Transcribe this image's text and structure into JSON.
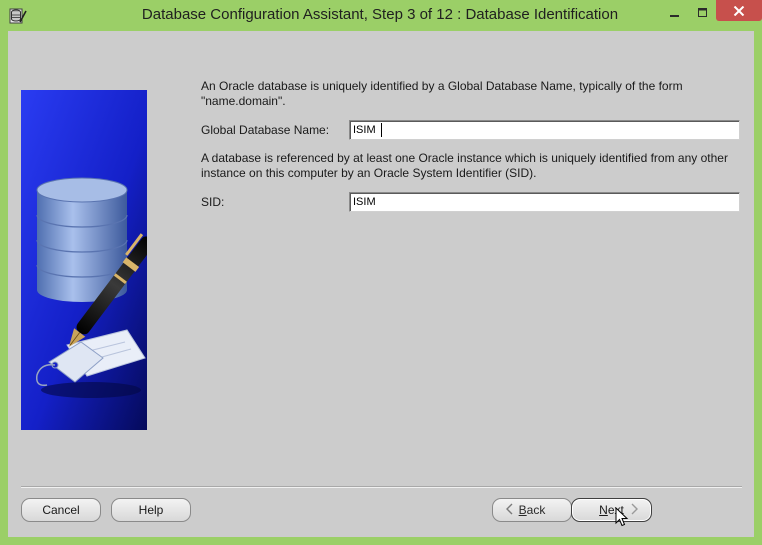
{
  "window": {
    "title": "Database Configuration Assistant, Step 3 of 12 : Database Identification",
    "accent_color": "#9bcf67",
    "close_color": "#c7504c",
    "icons": {
      "app": "database-app-icon",
      "minimize": "minimize-icon",
      "maximize": "maximize-icon",
      "close": "close-icon"
    }
  },
  "content": {
    "global_db_description": "An Oracle database is uniquely identified by a Global Database Name, typically of the form \"name.domain\".",
    "global_db_label": "Global Database Name:",
    "global_db_value": "ISIM",
    "sid_description": "A database is referenced by at least one Oracle instance which is uniquely identified from any other instance on this computer by an Oracle System Identifier (SID).",
    "sid_label": "SID:",
    "sid_value": "ISIM",
    "illustration": "database-pen-illustration"
  },
  "buttons": {
    "cancel": "Cancel",
    "help": "Help",
    "back_prefix": "",
    "back_mnemonic": "B",
    "back_rest": "ack",
    "next_prefix": "",
    "next_mnemonic": "N",
    "next_rest": "ext"
  }
}
